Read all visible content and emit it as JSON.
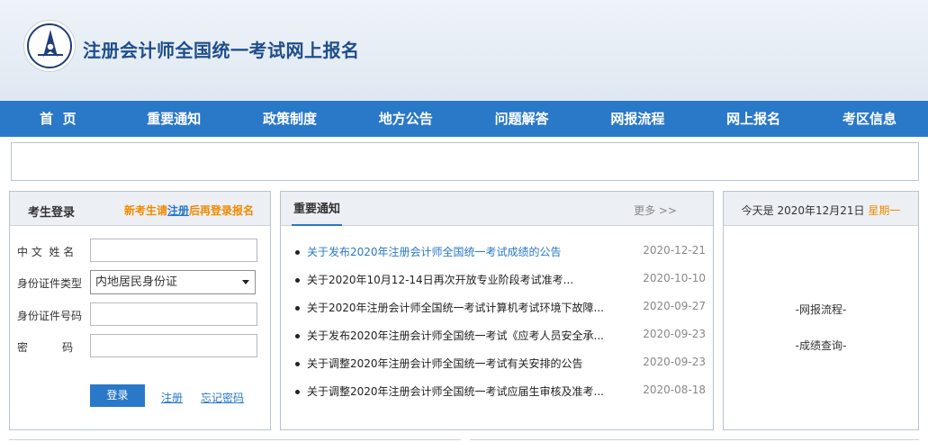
{
  "header": {
    "site_title": "注册会计师全国统一考试网上报名"
  },
  "nav": [
    "首  页",
    "重要通知",
    "政策制度",
    "地方公告",
    "问题解答",
    "网报流程",
    "网上报名",
    "考区信息"
  ],
  "login": {
    "title": "考生登录",
    "tip_before": "新考生请",
    "tip_link": "注册",
    "tip_after": "后再登录报名",
    "name_label": "中 文  姓 名",
    "id_type_label": "身份证件类型",
    "id_type_value": "内地居民身份证",
    "id_number_label": "身份证件号码",
    "password_label": "密          码",
    "login_button": "登录",
    "register_link": "注册",
    "forgot_link": "忘记密码"
  },
  "news": {
    "tab": "重要通知",
    "more": "更多 >>",
    "items": [
      {
        "title": "关于发布2020年注册会计师全国统一考试成绩的公告",
        "date": "2020-12-21"
      },
      {
        "title": "关于2020年10月12-14日再次开放专业阶段考试准考...",
        "date": "2020-10-10"
      },
      {
        "title": "关于2020年注册会计师全国统一考试计算机考试环境下故障...",
        "date": "2020-09-27"
      },
      {
        "title": "关于发布2020年注册会计师全国统一考试《应考人员安全承...",
        "date": "2020-09-23"
      },
      {
        "title": "关于调整2020年注册会计师全国统一考试有关安排的公告",
        "date": "2020-09-23"
      },
      {
        "title": "关于调整2020年注册会计师全国统一考试应届生审核及准考...",
        "date": "2020-08-18"
      }
    ]
  },
  "info": {
    "date_text": "今天是 2020年12月21日 ",
    "weekday": "星期一",
    "link1": "-网报流程-",
    "link2": "-成绩查询-"
  },
  "colors": {
    "nav_blue": "#2a78c8",
    "accent_orange": "#f08a00",
    "title_blue": "#1f4e8a"
  }
}
